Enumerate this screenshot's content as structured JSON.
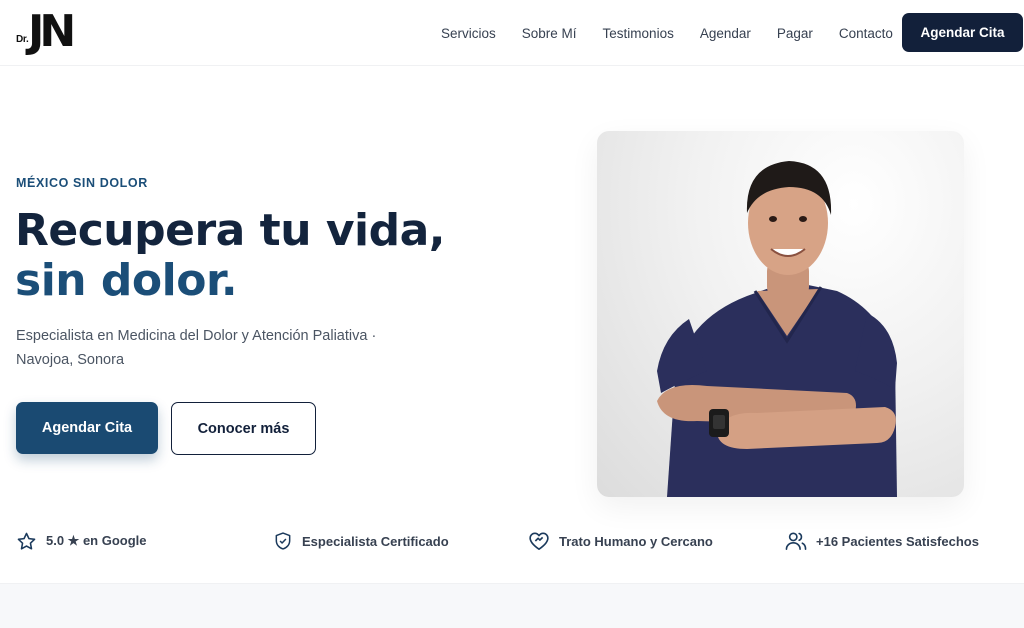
{
  "logo": {
    "prefix": "Dr.",
    "initials": "JN"
  },
  "nav": {
    "links": [
      "Servicios",
      "Sobre Mí",
      "Testimonios",
      "Agendar",
      "Pagar",
      "Contacto"
    ],
    "cta": "Agendar Cita"
  },
  "hero": {
    "eyebrow": "MÉXICO SIN DOLOR",
    "title_line1": "Recupera tu vida,",
    "title_line2": "sin dolor.",
    "subtitle": "Especialista en Medicina del Dolor y Atención Paliativa · Navojoa, Sonora",
    "primary_button": "Agendar Cita",
    "secondary_button": "Conocer más"
  },
  "trust": [
    {
      "icon": "star-icon",
      "label": "5.0 ★ en Google"
    },
    {
      "icon": "shield-check-icon",
      "label": "Especialista Certificado"
    },
    {
      "icon": "heart-handshake-icon",
      "label": "Trato Humano y Cercano"
    },
    {
      "icon": "users-icon",
      "label": "+16 Pacientes Satisfechos"
    }
  ],
  "colors": {
    "navy": "#12203a",
    "brand_blue": "#1b4e78",
    "button_blue": "#1a4a72",
    "accent_red": "#b03a3a"
  }
}
